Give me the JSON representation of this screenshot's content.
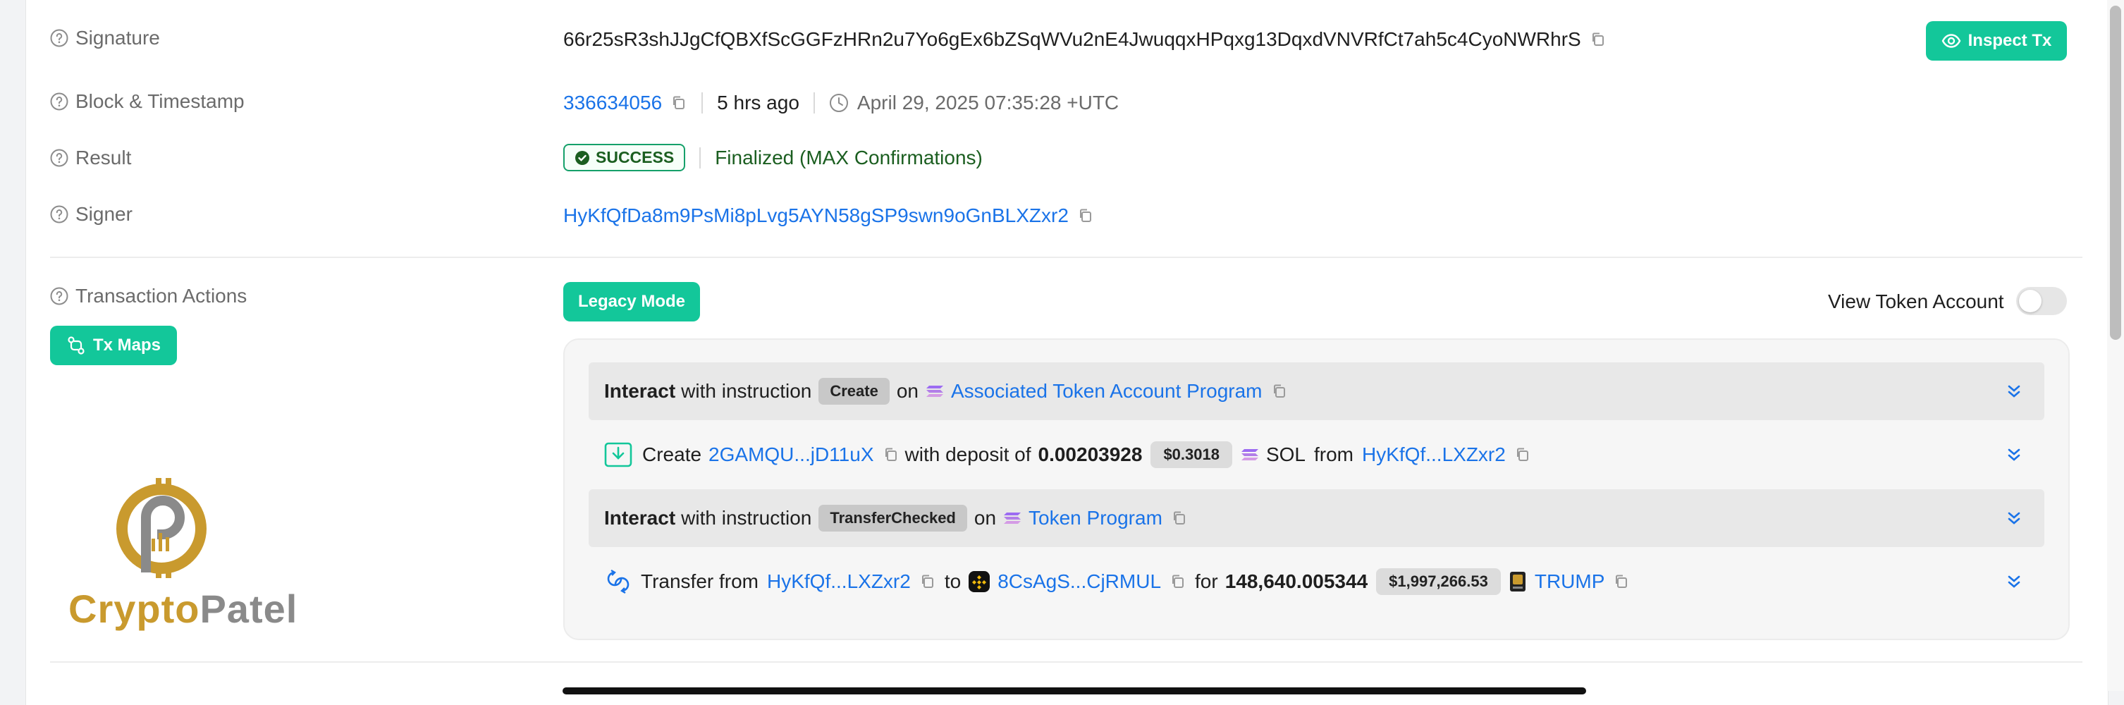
{
  "details": {
    "signature_label": "Signature",
    "signature_value": "66r25sR3shJJgCfQBXfScGGFzHRn2u7Yo6gEx6bZSqWVu2nE4JwuqqxHPqxg13DqxdVNVRfCt7ah5c4CyoNWRhrS",
    "inspect_button": "Inspect Tx",
    "block_label": "Block & Timestamp",
    "block_number": "336634056",
    "time_ago": "5 hrs ago",
    "timestamp": "April 29, 2025 07:35:28 +UTC",
    "result_label": "Result",
    "result_badge": "SUCCESS",
    "result_status": "Finalized (MAX Confirmations)",
    "signer_label": "Signer",
    "signer_value": "HyKfQfDa8m9PsMi8pLvg5AYN58gSP9swn9oGnBLXZxr2"
  },
  "actions": {
    "label": "Transaction Actions",
    "tx_maps_button": "Tx Maps",
    "legacy_mode_button": "Legacy Mode",
    "view_token_account_label": "View Token Account",
    "view_token_account_on": false,
    "logo_text_left": "Crypto",
    "logo_text_right": "Patel",
    "instructions": [
      {
        "interact": "Interact",
        "with_instruction": "with instruction",
        "instruction": "Create",
        "on": "on",
        "program": "Associated Token Account Program",
        "detail": {
          "verb": "Create",
          "account": "2GAMQU...jD11uX",
          "with_deposit": "with deposit of",
          "amount": "0.00203928",
          "usd": "$0.3018",
          "token": "SOL",
          "from": "from",
          "source": "HyKfQf...LXZxr2"
        }
      },
      {
        "interact": "Interact",
        "with_instruction": "with instruction",
        "instruction": "TransferChecked",
        "on": "on",
        "program": "Token Program",
        "detail": {
          "verb": "Transfer from",
          "source": "HyKfQf...LXZxr2",
          "to": "to",
          "destination": "8CsAgS...CjRMUL",
          "for": "for",
          "amount": "148,640.005344",
          "usd": "$1,997,266.53",
          "token": "TRUMP"
        }
      }
    ]
  },
  "colors": {
    "accent": "#13c79a",
    "link": "#1a73e8",
    "success_text": "#1b5e20",
    "logo_gold": "#c99a2e",
    "logo_grey": "#8a8a8a"
  }
}
